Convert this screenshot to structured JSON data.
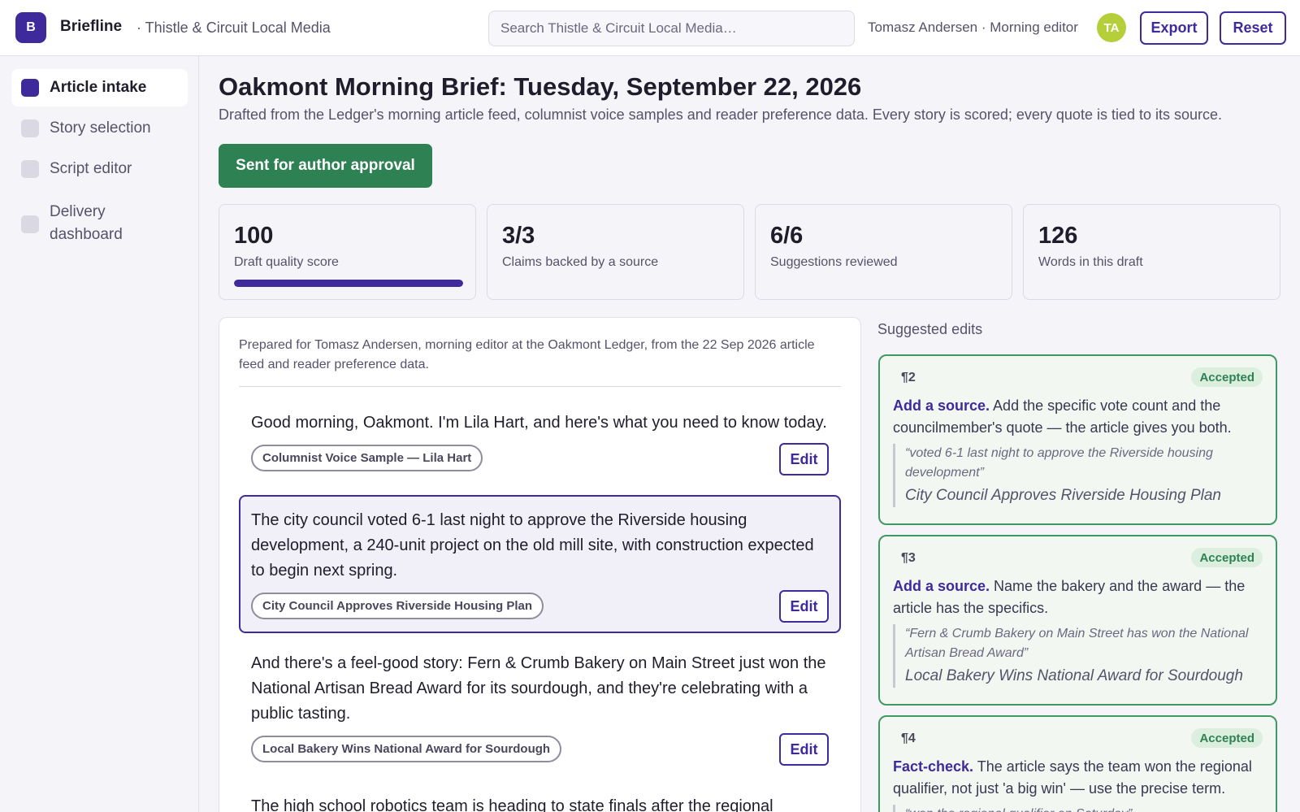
{
  "header": {
    "logo_letter": "B",
    "app_name": "Briefline",
    "org_name": "· Thistle & Circuit Local Media",
    "search_placeholder": "Search Thistle & Circuit Local Media…",
    "user_label": "Tomasz Andersen · Morning editor",
    "avatar_initials": "TA",
    "export_label": "Export",
    "reset_label": "Reset"
  },
  "sidebar": {
    "items": [
      {
        "label": "Article intake",
        "active": true
      },
      {
        "label": "Story selection",
        "active": false
      },
      {
        "label": "Script editor",
        "active": false
      },
      {
        "label": "Delivery dashboard",
        "active": false
      }
    ]
  },
  "main": {
    "title": "Oakmont Morning Brief: Tuesday, September 22, 2026",
    "subtitle": "Drafted from the Ledger's morning article feed, columnist voice samples and reader preference data. Every story is scored; every quote is tied to its source.",
    "status_button": "Sent for author approval"
  },
  "stats": [
    {
      "value": "100",
      "label": "Draft quality score",
      "progress": 1.0
    },
    {
      "value": "3/3",
      "label": "Claims backed by a source"
    },
    {
      "value": "6/6",
      "label": "Suggestions reviewed"
    },
    {
      "value": "126",
      "label": "Words in this draft"
    }
  ],
  "script": {
    "prepared_note": "Prepared for Tomasz Andersen, morning editor at the Oakmont Ledger, from the 22 Sep 2026 article feed and reader preference data.",
    "edit_label": "Edit",
    "paragraphs": [
      {
        "text": "Good morning, Oakmont. I'm Lila Hart, and here's what you need to know today.",
        "source": "Columnist Voice Sample — Lila Hart"
      },
      {
        "text": "The city council voted 6-1 last night to approve the Riverside housing development, a 240-unit project on the old mill site, with construction expected to begin next spring.",
        "source": "City Council Approves Riverside Housing Plan"
      },
      {
        "text": "And there's a feel-good story: Fern & Crumb Bakery on Main Street just won the National Artisan Bread Award for its sourdough, and they're celebrating with a public tasting.",
        "source": "Local Bakery Wins National Award for Sourdough"
      },
      {
        "text": "The high school robotics team is heading to state finals after the regional"
      }
    ]
  },
  "suggestions": {
    "title": "Suggested edits",
    "items": [
      {
        "para": "¶2",
        "status": "Accepted",
        "kind": "Add a source.",
        "text": "Add the specific vote count and the councilmember's quote — the article gives you both.",
        "quote": "“voted 6-1 last night to approve the Riverside housing development”",
        "source": "City Council Approves Riverside Housing Plan"
      },
      {
        "para": "¶3",
        "status": "Accepted",
        "kind": "Add a source.",
        "text": "Name the bakery and the award — the article has the specifics.",
        "quote": "“Fern & Crumb Bakery on Main Street has won the National Artisan Bread Award”",
        "source": "Local Bakery Wins National Award for Sourdough"
      },
      {
        "para": "¶4",
        "status": "Accepted",
        "kind": "Fact-check.",
        "text": "The article says the team won the regional qualifier, not just 'a big win' — use the precise term.",
        "quote": "“won the regional qualifier on Saturday”",
        "source": ""
      }
    ]
  },
  "colors": {
    "accent": "#3f2a9c",
    "success": "#2e8153",
    "avatar": "#b5cf3a"
  }
}
